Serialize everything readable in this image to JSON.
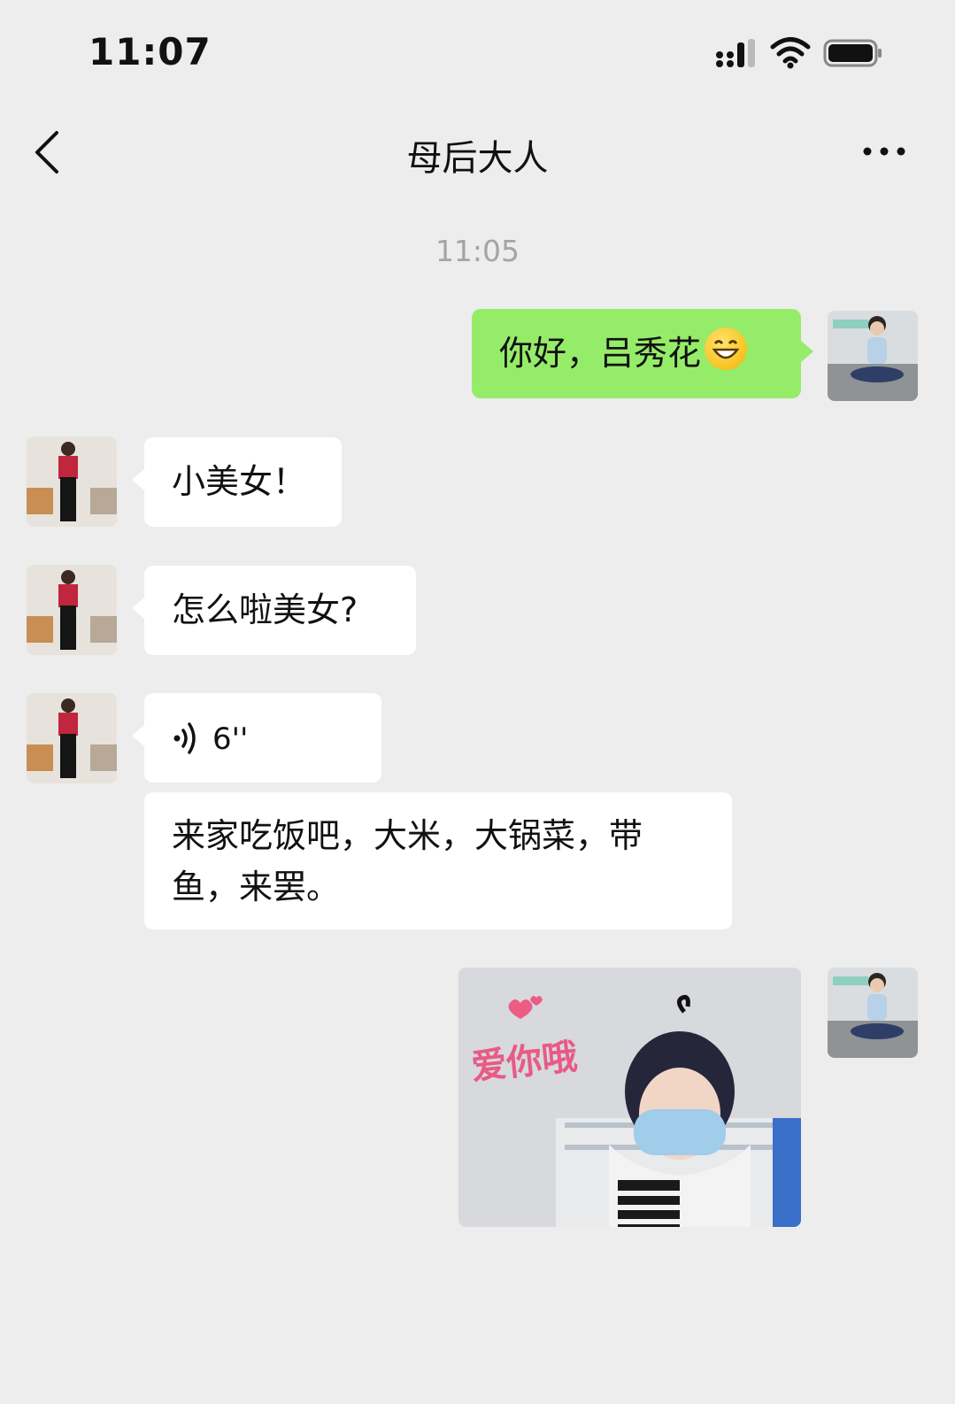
{
  "status_bar": {
    "time": "11:07"
  },
  "nav": {
    "title": "母后大人"
  },
  "chat": {
    "timestamp": "11:05",
    "messages": [
      {
        "side": "right",
        "type": "text",
        "text": "你好，吕秀花"
      },
      {
        "side": "left",
        "type": "text",
        "text": "小美女！"
      },
      {
        "side": "left",
        "type": "text",
        "text": "怎么啦美女?"
      },
      {
        "side": "left",
        "type": "voice",
        "duration": "6''"
      },
      {
        "side": "left",
        "type": "text",
        "text": "来家吃饭吧，大米，大锅菜，带鱼，来罢。"
      },
      {
        "side": "right",
        "type": "image",
        "sticker_text": "爱你哦"
      }
    ]
  },
  "colors": {
    "background": "#ededed",
    "outgoing_bubble": "#95ec69",
    "incoming_bubble": "#ffffff",
    "timestamp_text": "#a4a4a4"
  },
  "icons": [
    "signal-icon",
    "wifi-icon",
    "battery-icon",
    "back-icon",
    "more-icon",
    "voice-icon",
    "grin-emoji-icon",
    "heart-icon"
  ]
}
